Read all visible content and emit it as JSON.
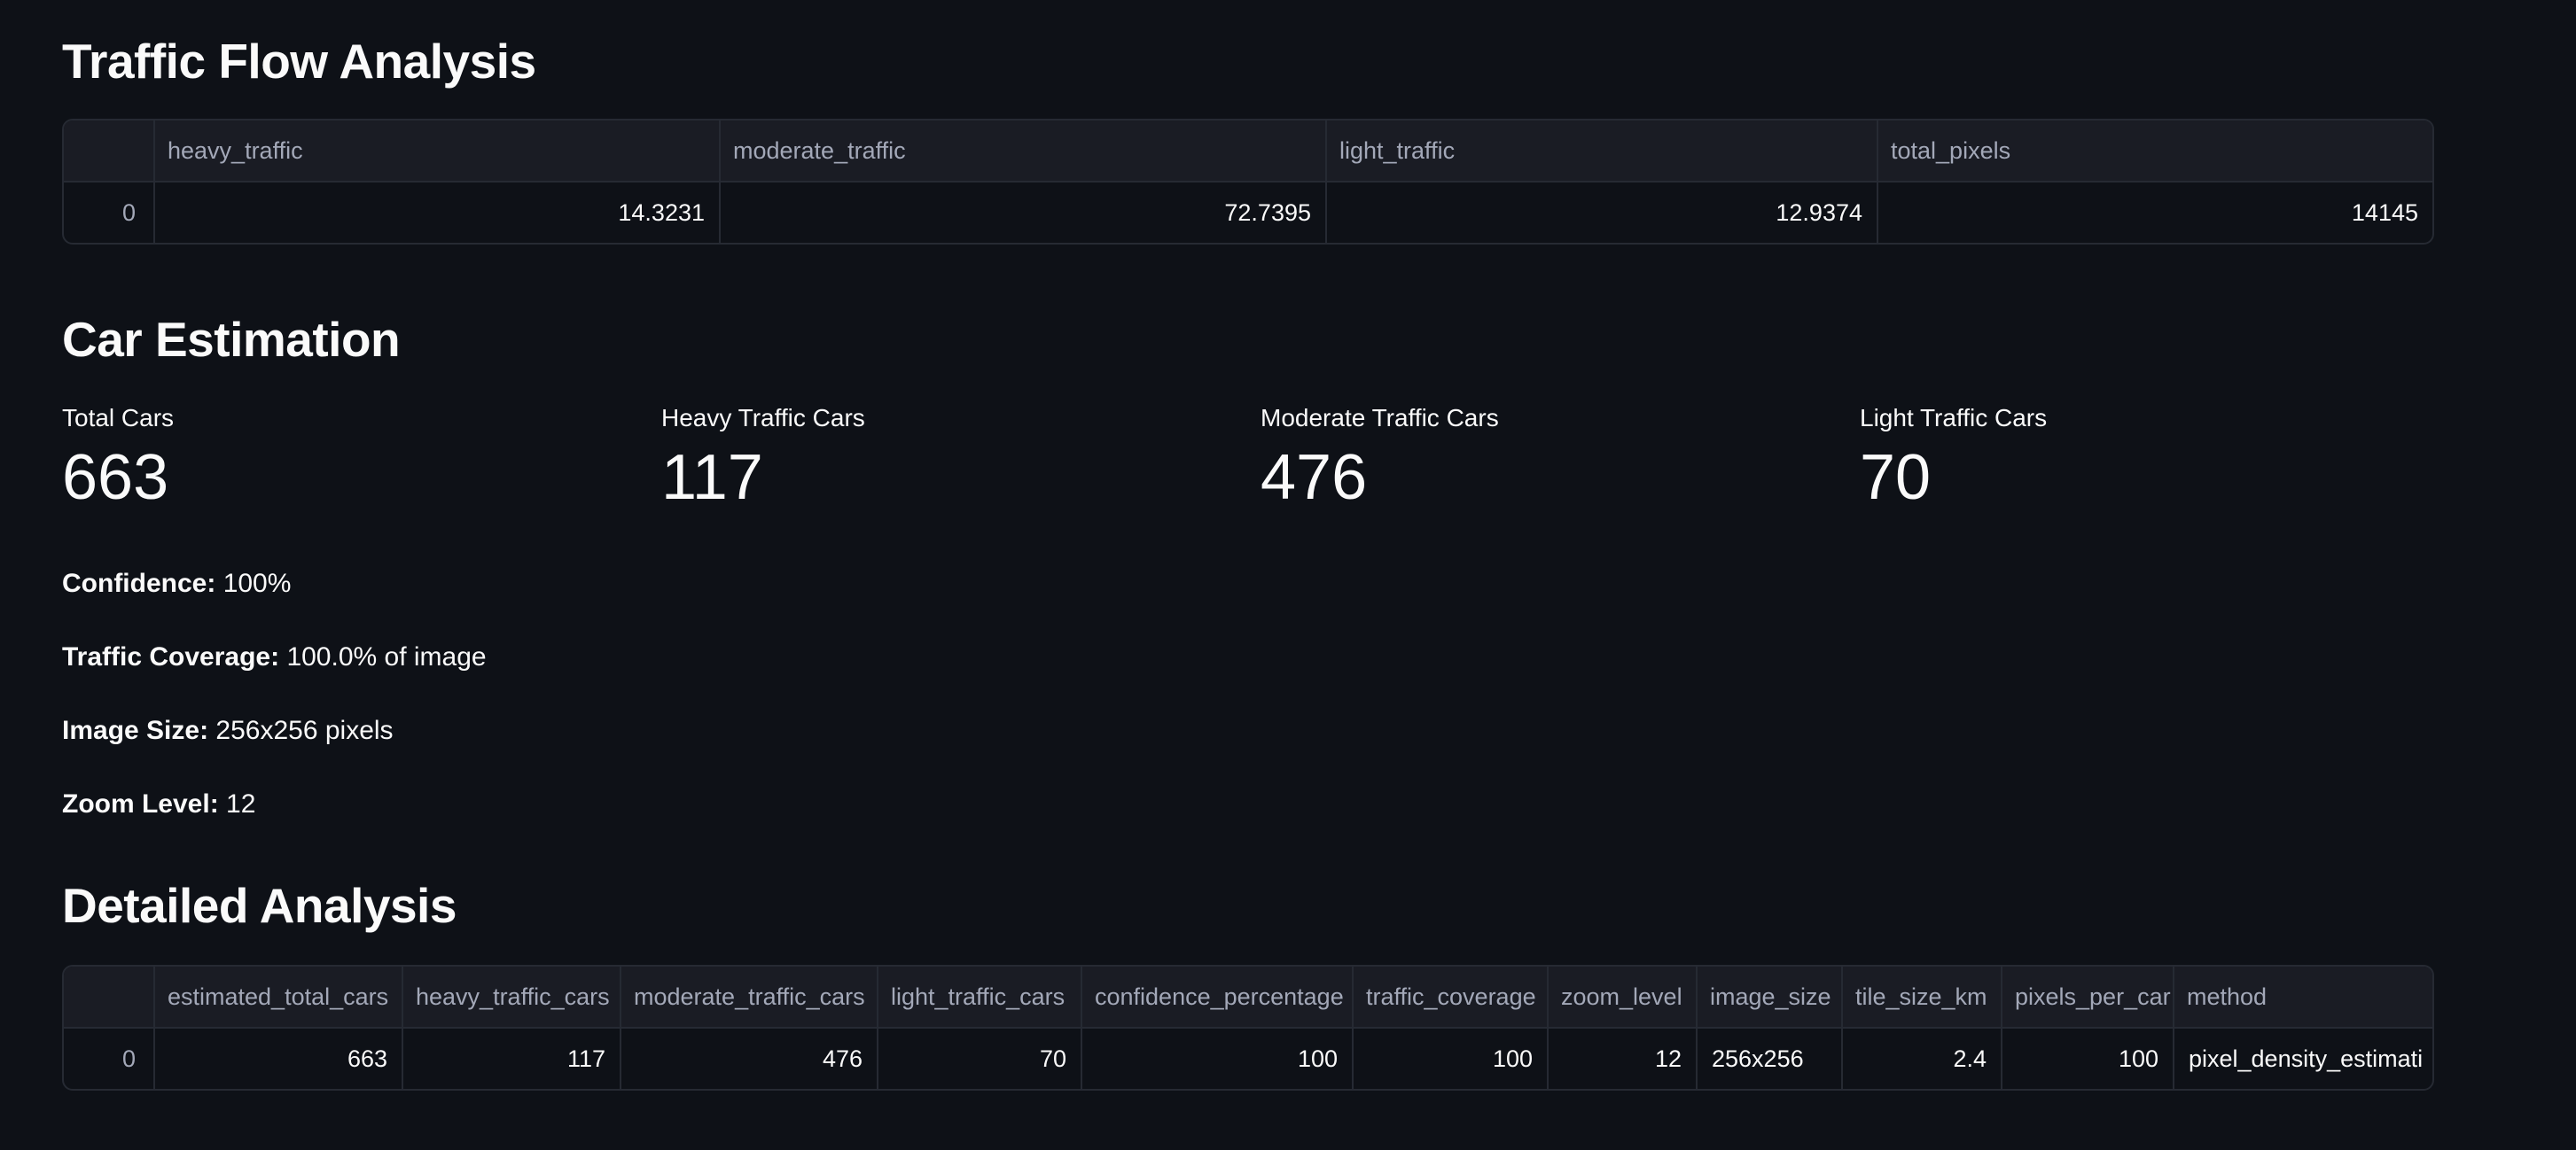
{
  "traffic_flow": {
    "title": "Traffic Flow Analysis",
    "columns": [
      "",
      "heavy_traffic",
      "moderate_traffic",
      "light_traffic",
      "total_pixels"
    ],
    "rows": [
      [
        "0",
        "14.3231",
        "72.7395",
        "12.9374",
        "14145"
      ]
    ]
  },
  "car_estimation": {
    "title": "Car Estimation",
    "metrics": [
      {
        "label": "Total Cars",
        "value": "663"
      },
      {
        "label": "Heavy Traffic Cars",
        "value": "117"
      },
      {
        "label": "Moderate Traffic Cars",
        "value": "476"
      },
      {
        "label": "Light Traffic Cars",
        "value": "70"
      }
    ],
    "info": [
      {
        "label": "Confidence:",
        "value": "100%"
      },
      {
        "label": "Traffic Coverage:",
        "value": "100.0% of image"
      },
      {
        "label": "Image Size:",
        "value": "256x256 pixels"
      },
      {
        "label": "Zoom Level:",
        "value": "12"
      }
    ]
  },
  "detailed_analysis": {
    "title": "Detailed Analysis",
    "columns": [
      "",
      "estimated_total_cars",
      "heavy_traffic_cars",
      "moderate_traffic_cars",
      "light_traffic_cars",
      "confidence_percentage",
      "traffic_coverage",
      "zoom_level",
      "image_size",
      "tile_size_km",
      "pixels_per_car",
      "method"
    ],
    "rows": [
      [
        "0",
        "663",
        "117",
        "476",
        "70",
        "100",
        "100",
        "12",
        "256x256",
        "2.4",
        "100",
        "pixel_density_estimati"
      ]
    ]
  }
}
